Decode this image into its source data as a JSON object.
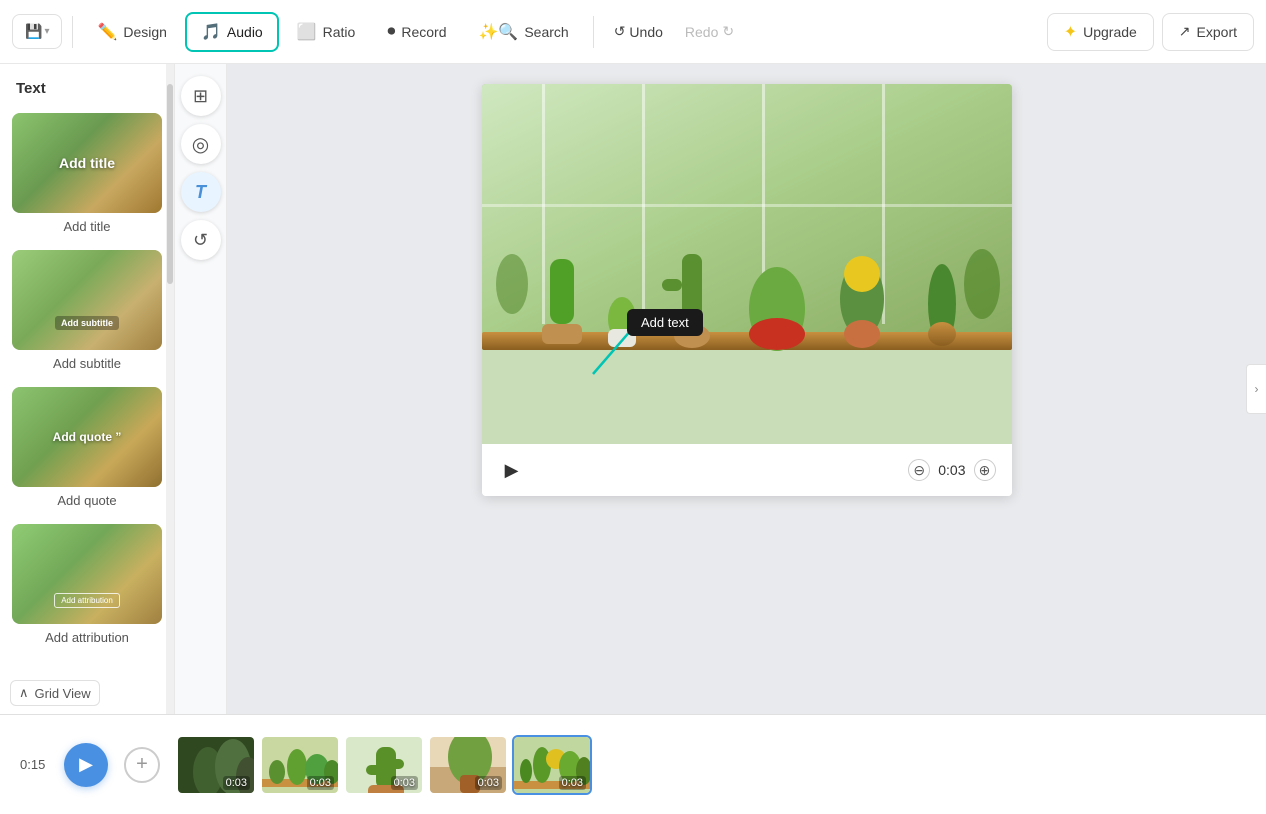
{
  "toolbar": {
    "save_label": "Save",
    "design_label": "Design",
    "audio_label": "Audio",
    "ratio_label": "Ratio",
    "record_label": "Record",
    "search_label": "Search",
    "undo_label": "Undo",
    "redo_label": "Redo",
    "upgrade_label": "Upgrade",
    "export_label": "Export"
  },
  "panel": {
    "header": "Text",
    "items": [
      {
        "label": "Add title",
        "overlay": "Add title"
      },
      {
        "label": "Add subtitle",
        "overlay": "Add subtitle"
      },
      {
        "label": "Add quote",
        "overlay": "Add quote"
      },
      {
        "label": "Add attribution",
        "overlay": "Add attribution"
      }
    ]
  },
  "tools": {
    "layout_icon": "⊞",
    "color_icon": "◯",
    "text_icon": "T",
    "rotate_icon": "↺"
  },
  "tooltip": {
    "text": "Add text"
  },
  "canvas": {
    "time": "0:03",
    "play_icon": "▶",
    "minus_icon": "⊖",
    "plus_icon": "⊕"
  },
  "timeline": {
    "total_time": "0:15",
    "clips": [
      {
        "duration": "0:03",
        "active": false
      },
      {
        "duration": "0:03",
        "active": false
      },
      {
        "duration": "0:03",
        "active": false
      },
      {
        "duration": "0:03",
        "active": false
      },
      {
        "duration": "0:03",
        "active": true
      }
    ]
  },
  "grid_view": {
    "label": "Grid View"
  },
  "right_panel_toggle": "›"
}
